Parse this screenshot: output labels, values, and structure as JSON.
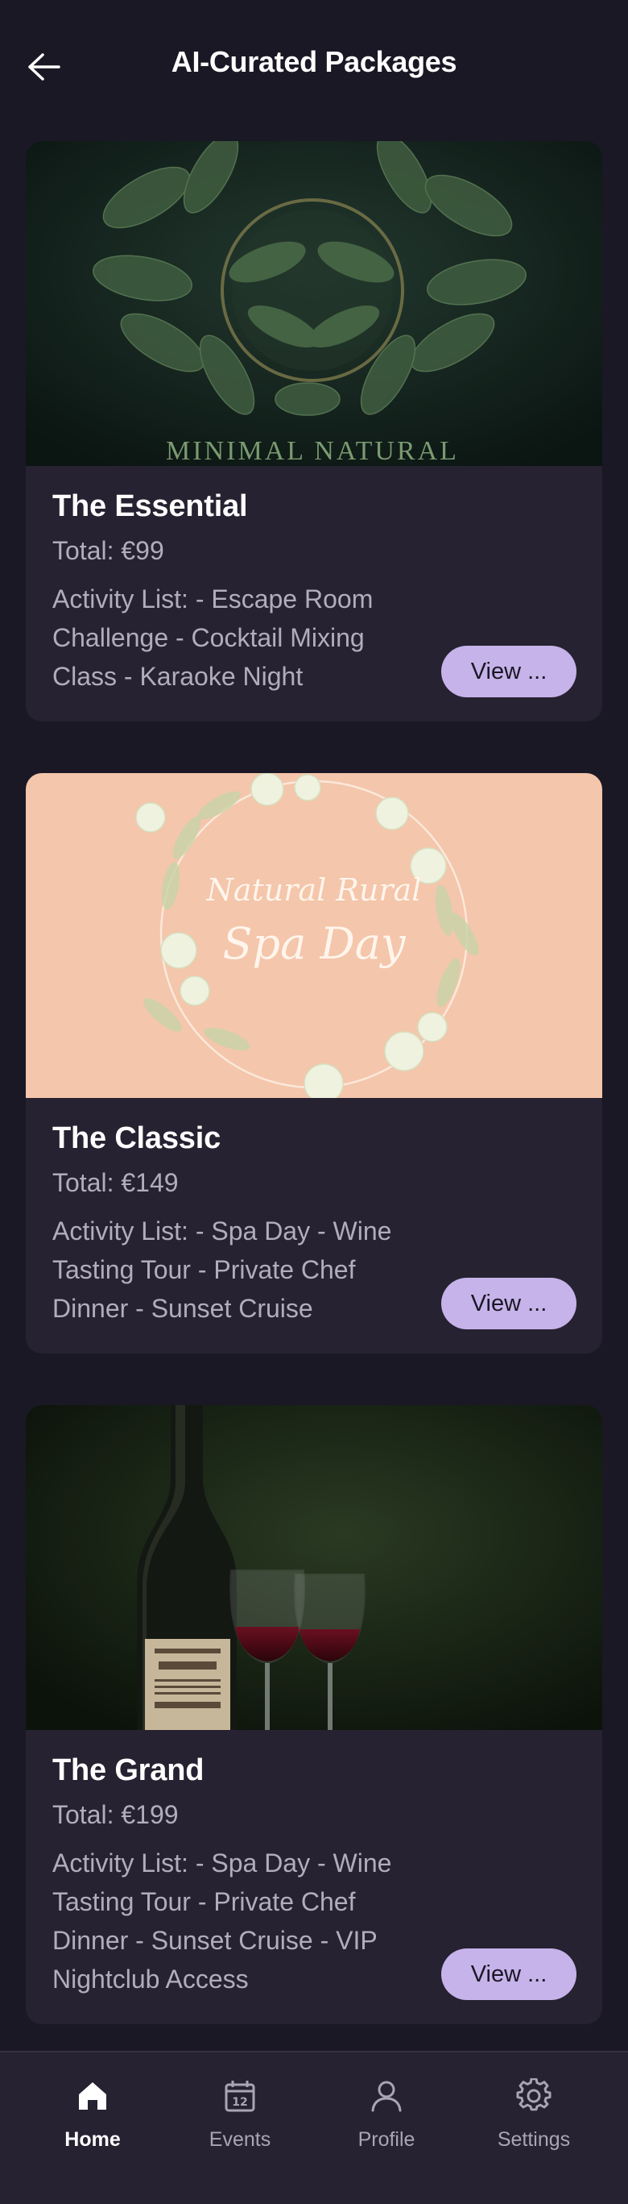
{
  "header": {
    "title": "AI-Curated Packages",
    "back_icon": "arrow-left-icon"
  },
  "packages": [
    {
      "image": "minimal-natural-leaves-image",
      "image_text": "MINIMAL NATURAL",
      "title": "The Essential",
      "total": "Total: €99",
      "activities": "Activity List: - Escape Room Challenge - Cocktail Mixing Class - Karaoke Night",
      "button": "View ..."
    },
    {
      "image": "spa-day-floral-wreath-image",
      "image_text_1": "Natural Rural",
      "image_text_2": "Spa Day",
      "title": "The Classic",
      "total": "Total: €149",
      "activities": "Activity List: - Spa Day - Wine Tasting Tour - Private Chef Dinner - Sunset Cruise",
      "button": "View ..."
    },
    {
      "image": "wine-bottle-glasses-image",
      "title": "The Grand",
      "total": "Total: €199",
      "activities": "Activity List: - Spa Day - Wine Tasting Tour - Private Chef Dinner - Sunset Cruise - VIP Nightclub Access",
      "button": "View ..."
    }
  ],
  "bottom_nav": {
    "items": [
      {
        "label": "Home",
        "icon": "home-icon",
        "active": true
      },
      {
        "label": "Events",
        "icon": "calendar-icon",
        "icon_text": "12",
        "active": false
      },
      {
        "label": "Profile",
        "icon": "user-icon",
        "active": false
      },
      {
        "label": "Settings",
        "icon": "gear-icon",
        "active": false
      }
    ]
  },
  "colors": {
    "background": "#1b1825",
    "card": "#262231",
    "accent": "#c6b3ea",
    "muted_text": "#b1adbd"
  }
}
